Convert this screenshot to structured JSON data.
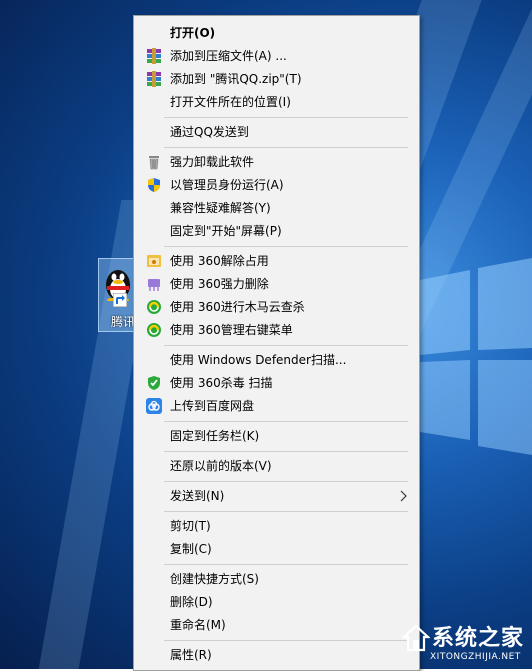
{
  "desktop_icon": {
    "label": "腾讯QQ"
  },
  "menu": {
    "items": [
      {
        "label": "打开(O)",
        "icon": ""
      },
      {
        "label": "添加到压缩文件(A) ...",
        "icon": "winrar-icon"
      },
      {
        "label": "添加到 \"腾讯QQ.zip\"(T)",
        "icon": "winrar-icon"
      },
      {
        "label": "打开文件所在的位置(I)",
        "icon": ""
      },
      {
        "label": "通过QQ发送到",
        "icon": ""
      },
      {
        "label": "强力卸载此软件",
        "icon": "trash-icon"
      },
      {
        "label": "以管理员身份运行(A)",
        "icon": "shield-icon"
      },
      {
        "label": "兼容性疑难解答(Y)",
        "icon": ""
      },
      {
        "label": "固定到\"开始\"屏幕(P)",
        "icon": ""
      },
      {
        "label": "使用 360解除占用",
        "icon": "unlock-360-icon"
      },
      {
        "label": "使用 360强力删除",
        "icon": "shred-360-icon"
      },
      {
        "label": "使用 360进行木马云查杀",
        "icon": "scan-360-icon"
      },
      {
        "label": "使用 360管理右键菜单",
        "icon": "menu-360-icon"
      },
      {
        "label": "使用 Windows Defender扫描...",
        "icon": ""
      },
      {
        "label": "使用 360杀毒 扫描",
        "icon": "antivirus-360-icon"
      },
      {
        "label": "上传到百度网盘",
        "icon": "baidu-cloud-icon"
      },
      {
        "label": "固定到任务栏(K)",
        "icon": ""
      },
      {
        "label": "还原以前的版本(V)",
        "icon": ""
      },
      {
        "label": "发送到(N)",
        "icon": "chevron-right-icon"
      },
      {
        "label": "剪切(T)",
        "icon": ""
      },
      {
        "label": "复制(C)",
        "icon": ""
      },
      {
        "label": "创建快捷方式(S)",
        "icon": ""
      },
      {
        "label": "删除(D)",
        "icon": ""
      },
      {
        "label": "重命名(M)",
        "icon": ""
      },
      {
        "label": "属性(R)",
        "icon": ""
      }
    ]
  },
  "watermark": {
    "title": "系统之家",
    "url": "XITONGZHIJIA.NET"
  },
  "colors": {
    "menu_bg": "#f2f2f2",
    "desktop_blue": "#1b62b8"
  }
}
